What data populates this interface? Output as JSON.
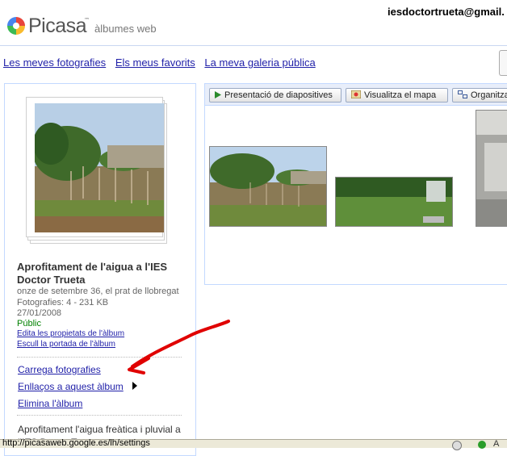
{
  "header": {
    "logo_word": "Picasa",
    "logo_tm": "™",
    "logo_sub": "àlbumes web",
    "user_email": "iesdoctortrueta@gmail."
  },
  "nav": {
    "items": [
      {
        "label": "Les meves fotografies"
      },
      {
        "label": "Els meus favorits"
      },
      {
        "label": "La meva galeria pública"
      }
    ]
  },
  "album": {
    "title": "Aprofitament de l'aigua a l'IES Doctor Trueta",
    "place": "onze de setembre 36, el prat de llobregat",
    "count": "Fotografies: 4 - 231 KB",
    "date": "27/01/2008",
    "visibility": "Públic",
    "edit_properties": "Edita les propietats de l'àlbum",
    "pick_cover": "Escull la portada de l'àlbum",
    "actions": {
      "upload": "Carrega fotografies",
      "links": "Enllaços a aquest àlbum",
      "delete": "Elimina l'àlbum"
    },
    "description": "Aprofitament l'aigua freàtica i pluvial a l'IES Doctor Trueta"
  },
  "toolbar": {
    "slideshow": "Presentació de diapositives",
    "map": "Visualitza el mapa",
    "organize": "Organitza"
  },
  "status": {
    "text": "http://picasaweb.google.es/lh/settings",
    "letter": "A"
  },
  "colors": {
    "link": "#1f1fa8",
    "public_green": "#008000",
    "annotation_red": "#e00000",
    "panel_border": "#c3d9ff"
  }
}
